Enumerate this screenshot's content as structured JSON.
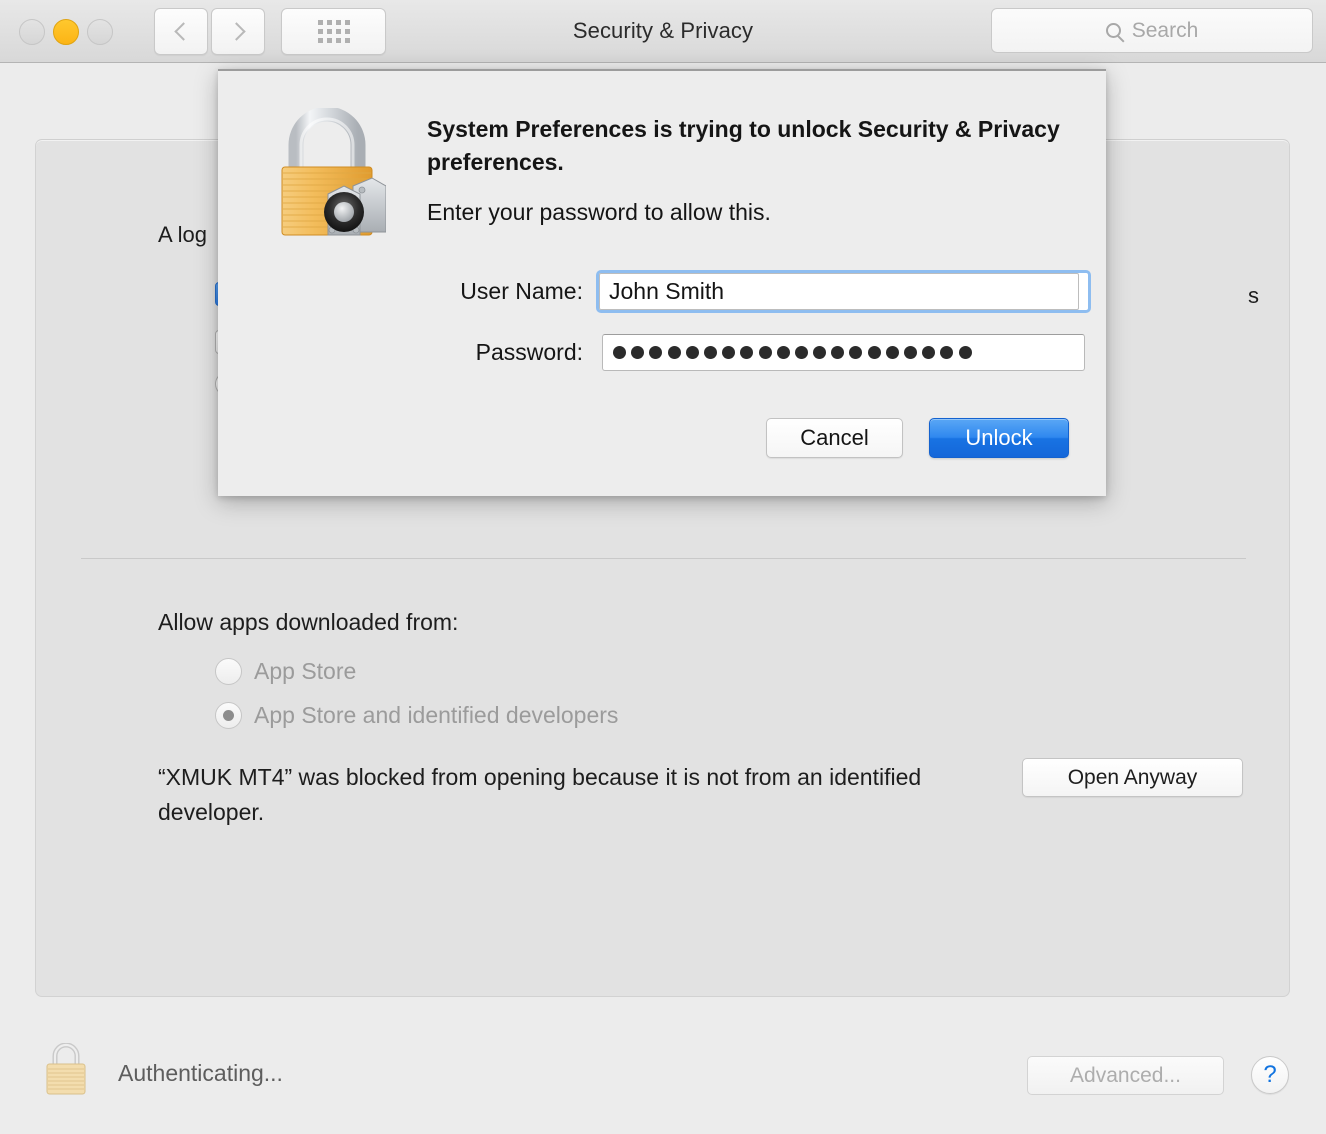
{
  "window": {
    "title": "Security & Privacy",
    "traffic_lights": {
      "close": "close-button",
      "minimize": "minimize-button",
      "zoom": "zoom-button"
    }
  },
  "toolbar": {
    "back_icon": "chevron-left-icon",
    "forward_icon": "chevron-right-icon",
    "show_all_icon": "grid-icon",
    "search": {
      "placeholder": "Search",
      "value": "",
      "icon": "search-icon"
    }
  },
  "background_panel": {
    "headline_fragment": "A log",
    "tail_fragment": "s",
    "allow_section": {
      "title": "Allow apps downloaded from:",
      "options": [
        {
          "label": "App Store",
          "selected": false,
          "enabled": false
        },
        {
          "label": "App Store and identified developers",
          "selected": true,
          "enabled": false
        }
      ]
    },
    "blocked_message": "“XMUK MT4” was blocked from opening because it is not from an identified developer.",
    "open_anyway_label": "Open Anyway"
  },
  "bottom_bar": {
    "lock_icon": "unlocked-padlock-icon",
    "status_text": "Authenticating...",
    "advanced_label": "Advanced...",
    "advanced_enabled": false,
    "help_label": "?"
  },
  "auth_sheet": {
    "lock_icon": "padlock-keychain-icon",
    "title": "System Preferences is trying to unlock Security & Privacy preferences.",
    "subtitle": "Enter your password to allow this.",
    "username_label": "User Name:",
    "username_value": "John Smith",
    "password_label": "Password:",
    "password_masked_length": 20,
    "cancel_label": "Cancel",
    "unlock_label": "Unlock"
  },
  "colors": {
    "accent_blue": "#1873e3",
    "focus_ring": "#8ebdf0",
    "help_blue": "#1274e0",
    "minimize_yellow": "#fcb415",
    "lock_gold": "#f0b84a",
    "window_bg": "#ececec",
    "panel_bg": "#e2e2e2",
    "sheet_bg": "#ededed",
    "disabled_text": "#9b9b9b"
  }
}
